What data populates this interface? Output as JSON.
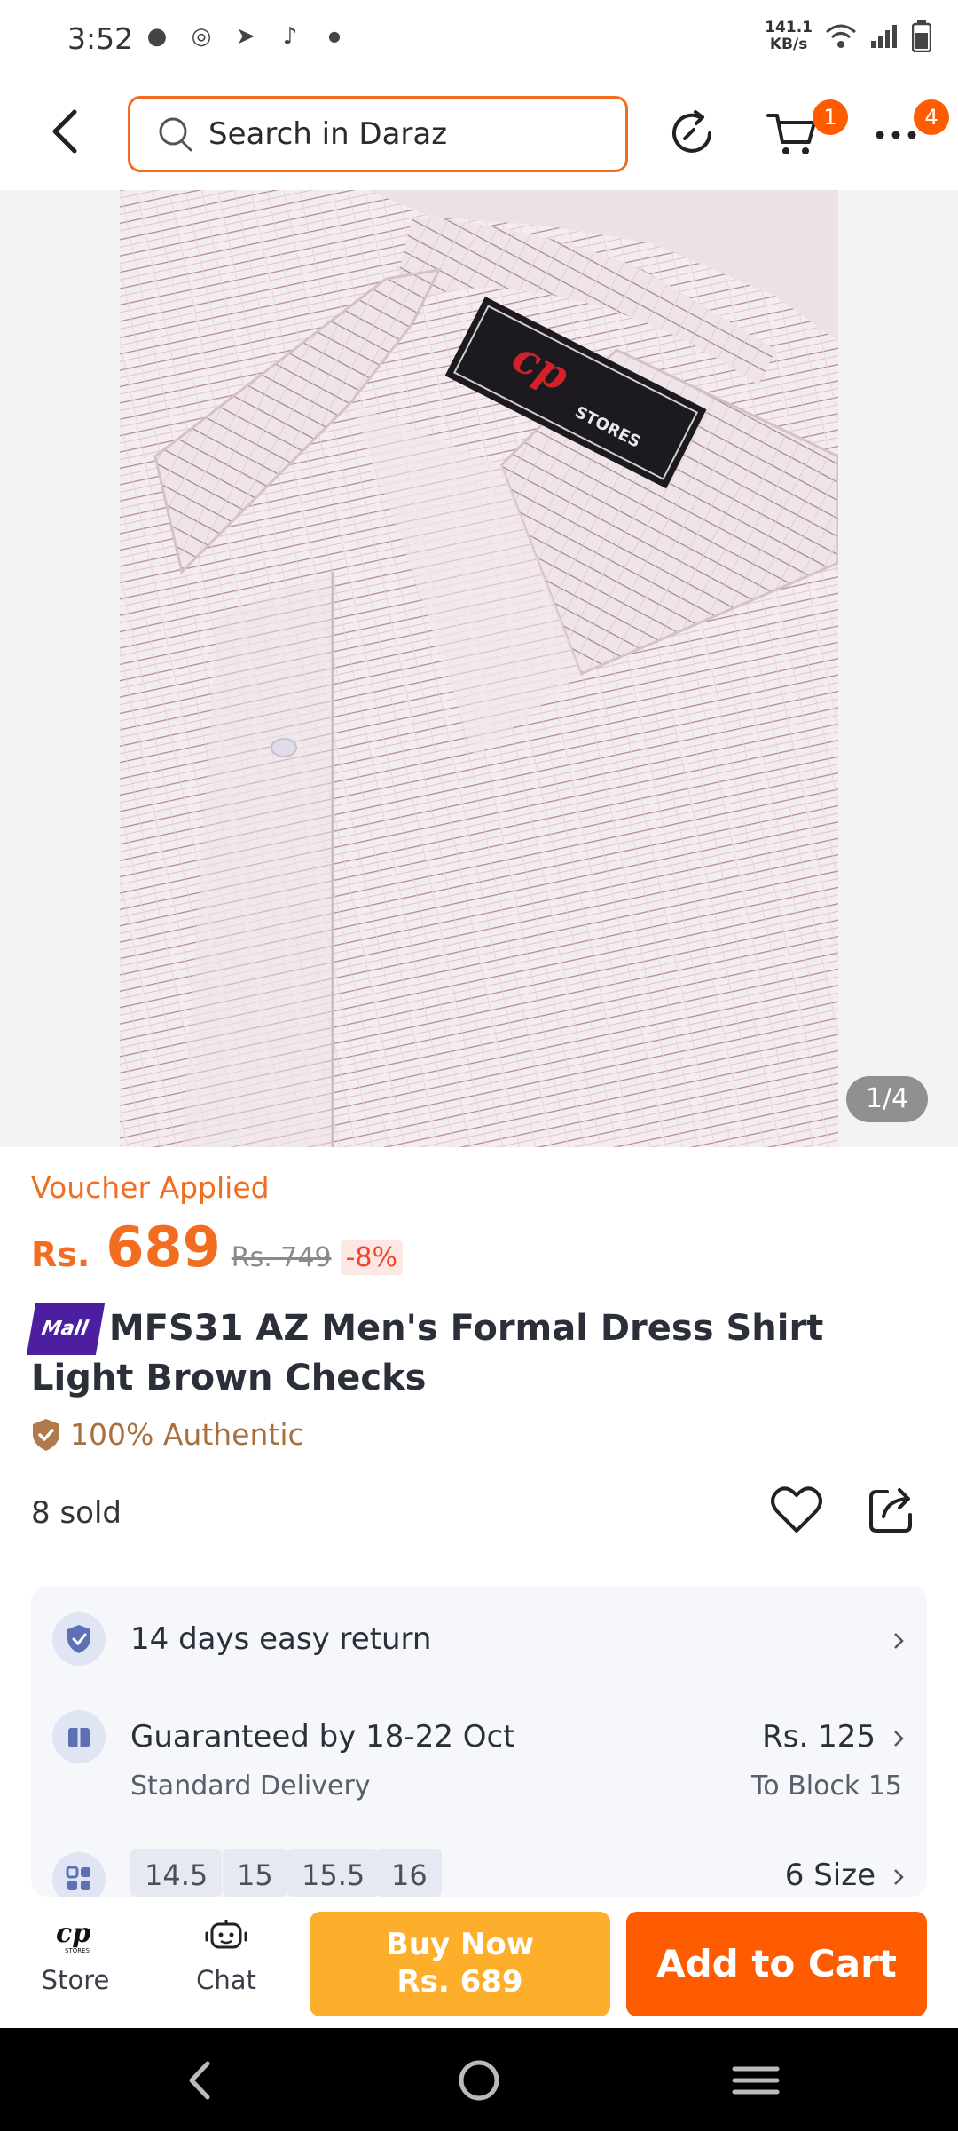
{
  "status_bar": {
    "time": "3:52",
    "net_speed_value": "141.1",
    "net_speed_unit": "KB/s"
  },
  "header": {
    "search_placeholder": "Search in Daraz",
    "cart_badge": "1",
    "more_badge": "4"
  },
  "gallery": {
    "counter": "1/4"
  },
  "product": {
    "voucher_label": "Voucher Applied",
    "price_currency": "Rs.",
    "price": "689",
    "original_price": "Rs. 749",
    "discount": "-8%",
    "mall_label": "Mall",
    "title": "MFS31 AZ Men's Formal Dress Shirt Light Brown Checks",
    "authentic_label": "100% Authentic",
    "sold": "8 sold"
  },
  "services": {
    "return_policy": "14 days easy return",
    "delivery_guarantee": "Guaranteed by 18-22 Oct",
    "delivery_type": "Standard Delivery",
    "delivery_fee": "Rs. 125",
    "delivery_location": "To Block 15",
    "sizes": [
      "14.5",
      "15",
      "15.5",
      "16"
    ],
    "size_count": "6 Size"
  },
  "action_bar": {
    "store_label": "Store",
    "chat_label": "Chat",
    "buy_now_label": "Buy Now",
    "buy_now_price": "Rs. 689",
    "add_to_cart_label": "Add to Cart"
  },
  "colors": {
    "accent": "#f36d21",
    "buy_now": "#fdaf2c",
    "add_to_cart": "#ff5b00",
    "mall": "#4b1fa0"
  }
}
